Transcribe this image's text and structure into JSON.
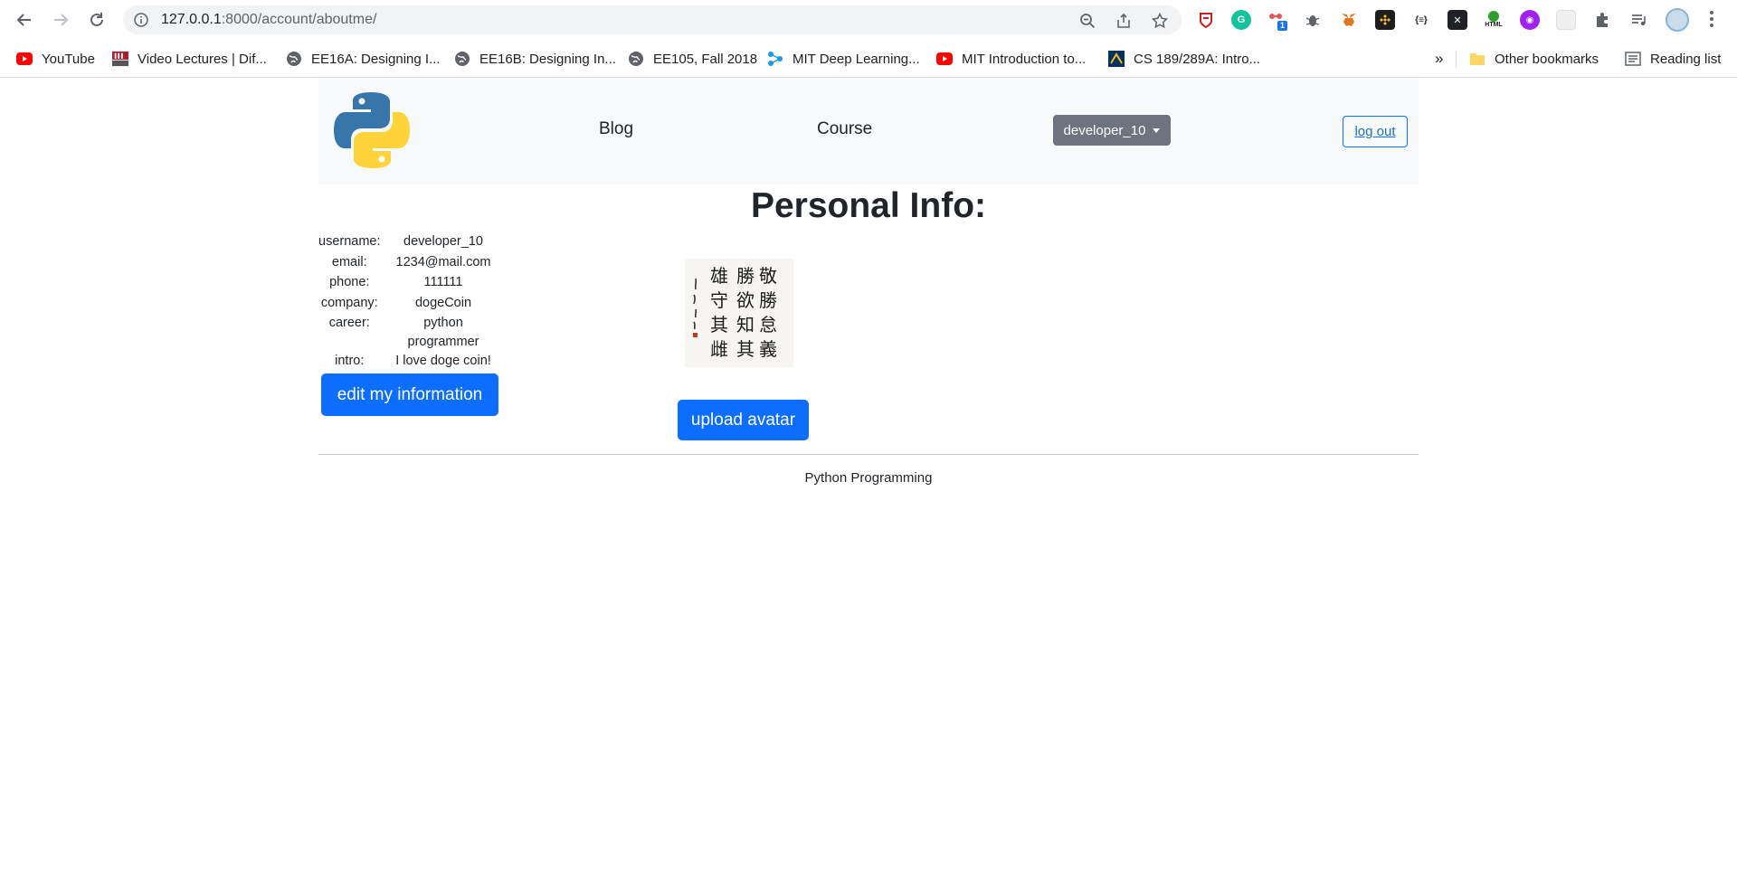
{
  "browser": {
    "url_host": "127.0.0.1",
    "url_path": ":8000/account/aboutme/",
    "extension_badge": "1",
    "ext_json_label": "{≡}",
    "ext_html_label": "HTML",
    "bookmarks": [
      {
        "label": "YouTube",
        "icon": "youtube-icon"
      },
      {
        "label": "Video Lectures | Dif...",
        "icon": "mit-ocw-icon"
      },
      {
        "label": "EE16A: Designing I...",
        "icon": "globe-icon"
      },
      {
        "label": "EE16B: Designing In...",
        "icon": "globe-icon"
      },
      {
        "label": "EE105, Fall 2018",
        "icon": "globe-icon"
      },
      {
        "label": "MIT Deep Learning...",
        "icon": "network-icon"
      },
      {
        "label": "MIT Introduction to...",
        "icon": "youtube-icon"
      },
      {
        "label": "CS 189/289A: Intro...",
        "icon": "berkeley-icon"
      }
    ],
    "overflow": "»",
    "other_bookmarks": "Other bookmarks",
    "reading_list": "Reading list"
  },
  "nav": {
    "blog": "Blog",
    "course": "Course",
    "user_dropdown": "developer_10",
    "logout": "log out"
  },
  "page": {
    "title": "Personal Info:",
    "info": [
      {
        "key": "username:",
        "value": "developer_10"
      },
      {
        "key": "email:",
        "value": "1234@mail.com"
      },
      {
        "key": "phone:",
        "value": "111111"
      },
      {
        "key": "company:",
        "value": "dogeCoin"
      },
      {
        "key": "career:",
        "value": "python programmer"
      },
      {
        "key": "intro:",
        "value": "I love doge coin!"
      }
    ],
    "edit_button": "edit my information",
    "upload_button": "upload avatar",
    "avatar_calligraphy": [
      "敬",
      "勝",
      "怠",
      "義",
      "勝",
      "欲",
      "知",
      "其",
      "雄",
      "守",
      "其",
      "雌"
    ],
    "footer": "Python Programming"
  },
  "colors": {
    "primary": "#0d6efd",
    "secondary": "#6c757d",
    "nav_bg": "#f8f9fa"
  }
}
